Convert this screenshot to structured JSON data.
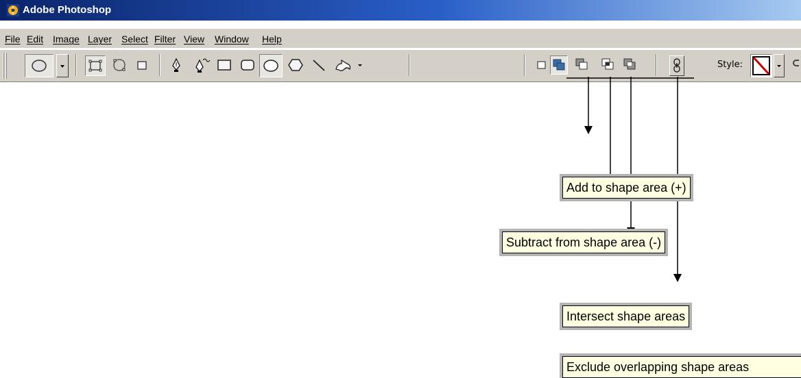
{
  "window": {
    "title": "Adobe Photoshop",
    "icon": "photoshop-app-icon"
  },
  "menu": [
    {
      "key": "file",
      "label": "File"
    },
    {
      "key": "edit",
      "label": "Edit"
    },
    {
      "key": "image",
      "label": "Image"
    },
    {
      "key": "layer",
      "label": "Layer"
    },
    {
      "key": "select",
      "label": "Select"
    },
    {
      "key": "filter",
      "label": "Filter"
    },
    {
      "key": "view",
      "label": "View"
    },
    {
      "key": "window",
      "label": "Window"
    },
    {
      "key": "help",
      "label": "Help"
    }
  ],
  "options_bar": {
    "style_label": "Style:",
    "active_shape_tool": "ellipse",
    "active_area_mode": "add-to-shape-area",
    "icons": [
      "ellipse-preset-icon",
      "shape-layers-icon",
      "paths-icon",
      "fill-pixels-icon",
      "pen-icon",
      "freeform-pen-icon",
      "rectangle-icon",
      "rounded-rectangle-icon",
      "ellipse-icon",
      "polygon-icon",
      "line-icon",
      "custom-shape-icon",
      "create-new-shape-icon",
      "add-to-shape-area-icon",
      "subtract-from-shape-area-icon",
      "intersect-shape-areas-icon",
      "exclude-overlapping-shape-areas-icon",
      "link-icon",
      "style-swatch-icon"
    ]
  },
  "tooltips": {
    "add": "Add to shape area (+)",
    "subtract": "Subtract from shape area (-)",
    "intersect": "Intersect shape areas",
    "exclude": "Exclude overlapping shape areas"
  },
  "colors": {
    "title_start": "#0a246a",
    "title_end": "#a6caf0",
    "chrome": "#d4d0c8",
    "tooltip_bg": "#ffffe1",
    "accent_blue": "#3a6ea5",
    "style_none_red": "#cc0000"
  }
}
